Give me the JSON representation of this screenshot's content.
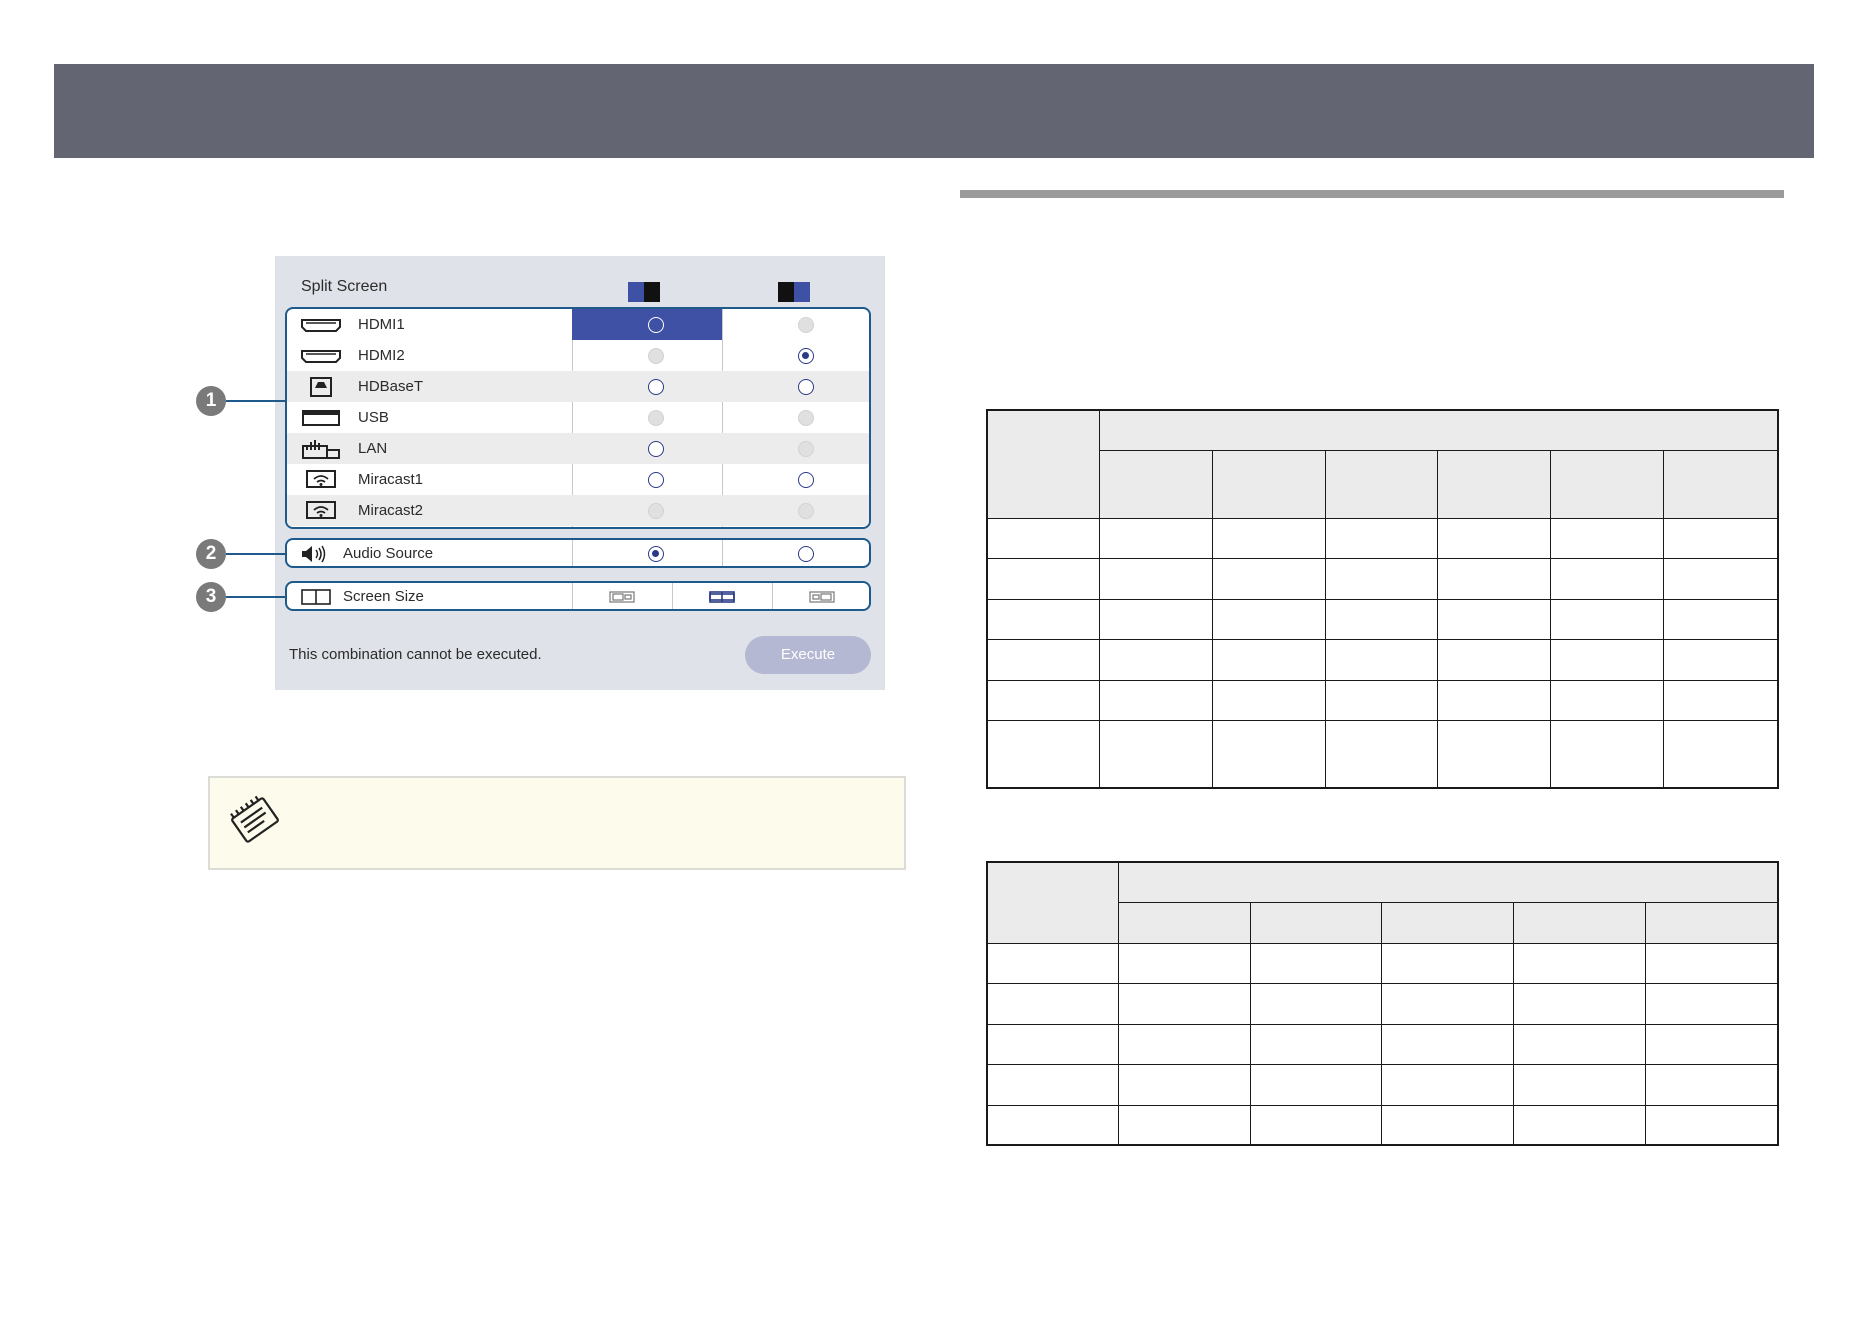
{
  "split_screen": {
    "title": "Split Screen",
    "layout_icons": [
      "left-screen-highlight-icon",
      "right-screen-highlight-icon"
    ],
    "sources": [
      {
        "label": "HDMI1",
        "icon": "hdmi-icon",
        "left": "selected-cell",
        "right": "disabled"
      },
      {
        "label": "HDMI2",
        "icon": "hdmi-icon",
        "left": "disabled",
        "right": "selected"
      },
      {
        "label": "HDBaseT",
        "icon": "hdbaset-icon",
        "left": "available",
        "right": "available"
      },
      {
        "label": "USB",
        "icon": "usb-display-icon",
        "left": "disabled",
        "right": "disabled"
      },
      {
        "label": "LAN",
        "icon": "lan-icon",
        "left": "available",
        "right": "disabled"
      },
      {
        "label": "Miracast1",
        "icon": "wifi-screen-icon",
        "left": "available",
        "right": "available"
      },
      {
        "label": "Miracast2",
        "icon": "wifi-screen-icon",
        "left": "disabled",
        "right": "disabled"
      }
    ],
    "audio_source": {
      "label": "Audio Source",
      "icon": "speaker-icon",
      "left": "selected",
      "right": "available"
    },
    "screen_size": {
      "label": "Screen Size",
      "icon": "screen-size-icon",
      "options": [
        "left-larger",
        "equal",
        "right-larger"
      ],
      "selected": "equal"
    },
    "message": "This combination cannot be executed.",
    "execute_label": "Execute",
    "callouts": [
      "1",
      "2",
      "3"
    ]
  },
  "note": {
    "icon": "note-pencil-icon"
  },
  "colors": {
    "header_band": "#636573",
    "accent": "#3f51a5",
    "callout_border": "#1e5a8c",
    "note_bg": "#fdfbeb"
  }
}
